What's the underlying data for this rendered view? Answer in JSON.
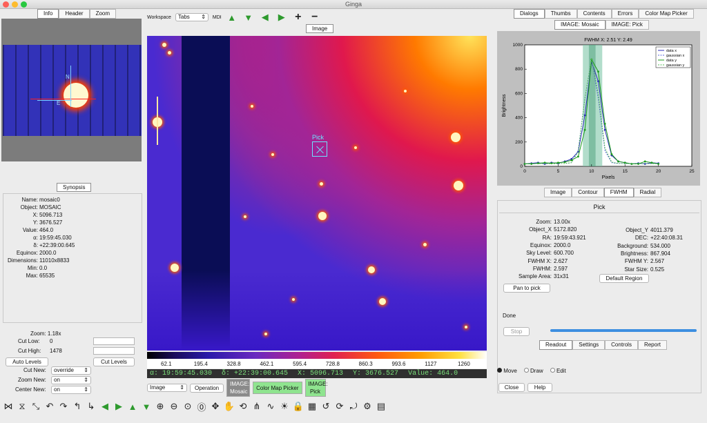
{
  "window": {
    "title": "Ginga"
  },
  "left": {
    "top_tabs": [
      "Info",
      "Header",
      "Zoom"
    ],
    "synopsis_label": "Synopsis",
    "info": [
      [
        "Name:",
        "mosaic0"
      ],
      [
        "Object:",
        "MOSAIC"
      ],
      [
        "X:",
        "5096.713"
      ],
      [
        "Y:",
        "3676.527"
      ],
      [
        "Value:",
        "464.0"
      ],
      [
        "α:",
        "19:59:45.030"
      ],
      [
        "δ:",
        "+22:39:00.645"
      ],
      [
        "Equinox:",
        "2000.0"
      ],
      [
        "Dimensions:",
        "11010x8833"
      ],
      [
        "Min:",
        "0.0"
      ],
      [
        "Max:",
        "65535"
      ]
    ],
    "zoom": "Zoom: 1.18x",
    "cut_low_label": "Cut Low:",
    "cut_low": "0",
    "cut_high_label": "Cut High:",
    "cut_high": "1478",
    "auto_levels": "Auto Levels",
    "cut_levels": "Cut Levels",
    "cut_new_label": "Cut New:",
    "cut_new": "override",
    "zoom_new_label": "Zoom New:",
    "zoom_new": "on",
    "center_new_label": "Center New:",
    "center_new": "on"
  },
  "center": {
    "workspace_label": "Workspace",
    "workspace_type": "Tabs",
    "mdi_label": "MDI",
    "image_tab": "Image",
    "pick_label": "Pick",
    "colorbar_ticks": [
      "62.1",
      "195.4",
      "328.8",
      "462.1",
      "595.4",
      "728.8",
      "860.3",
      "993.6",
      "1127",
      "1260"
    ],
    "readout": {
      "ra": "α: 19:59:45.030",
      "dec": "δ: +22:39:00.645",
      "x": "X: 5096.713",
      "y": "Y: 3676.527",
      "value": "Value: 464.0"
    },
    "channel_select": "Image",
    "operation": "Operation",
    "bottom_tabs": [
      [
        "IMAGE:",
        "Mosaic"
      ],
      [
        "Color Map Picker",
        ""
      ],
      [
        "IMAGE:",
        "Pick"
      ]
    ]
  },
  "right": {
    "top_tabs": [
      "Dialogs",
      "Thumbs",
      "Contents",
      "Errors",
      "Color Map Picker"
    ],
    "image_tabs": [
      "IMAGE: Mosaic",
      "IMAGE: Pick"
    ],
    "plot_tabs": [
      "Image",
      "Contour",
      "FWHM",
      "Radial"
    ],
    "pick_title": "Pick",
    "pick_left": [
      [
        "Zoom:",
        "13.00x"
      ],
      [
        "Object_X",
        "5172.820"
      ],
      [
        "RA:",
        "19:59:43.921"
      ],
      [
        "Equinox:",
        "2000.0"
      ],
      [
        "Sky Level:",
        "600.700"
      ],
      [
        "FWHM X:",
        "2.627"
      ],
      [
        "FWHM:",
        "2.597"
      ],
      [
        "Sample Area:",
        "31x31"
      ]
    ],
    "pick_right": [
      [
        "Object_Y",
        "4011.379"
      ],
      [
        "DEC:",
        "+22:40:08.31"
      ],
      [
        "Background:",
        "534.000"
      ],
      [
        "Brightness:",
        "867.904"
      ],
      [
        "FWHM Y:",
        "2.567"
      ],
      [
        "Star Size:",
        "0.525"
      ]
    ],
    "pan_to_pick": "Pan to pick",
    "default_region": "Default Region",
    "status": "Done",
    "stop": "Stop",
    "progress": 1.0,
    "lower_tabs": [
      "Readout",
      "Settings",
      "Controls",
      "Report"
    ],
    "modes": [
      "Move",
      "Draw",
      "Edit"
    ],
    "close": "Close",
    "help": "Help"
  },
  "chart_data": {
    "type": "line",
    "title": "FWHM X: 2.51  Y: 2.49",
    "xlabel": "Pixels",
    "ylabel": "Brightness",
    "xlim": [
      0,
      25
    ],
    "ylim": [
      0,
      1000
    ],
    "xticks": [
      "0",
      "5",
      "10",
      "15",
      "20",
      "25"
    ],
    "yticks": [
      "0",
      "200",
      "400",
      "600",
      "800",
      "1000"
    ],
    "legend_position": "top-right",
    "series": [
      {
        "name": "data x",
        "color": "#2b2bb8",
        "x": [
          0,
          1,
          2,
          3,
          4,
          5,
          6,
          7,
          8,
          9,
          10,
          11,
          12,
          13,
          14,
          15,
          16,
          17,
          18,
          19,
          20
        ],
        "values": [
          20,
          25,
          30,
          20,
          30,
          25,
          40,
          60,
          120,
          420,
          860,
          700,
          300,
          90,
          40,
          30,
          20,
          25,
          20,
          30,
          25
        ]
      },
      {
        "name": "gaussian x",
        "color": "#5566dd",
        "x": [
          0,
          1,
          2,
          3,
          4,
          5,
          6,
          7,
          8,
          9,
          10,
          11,
          12,
          13,
          14,
          15,
          16,
          17,
          18,
          19,
          20
        ],
        "values": [
          22,
          22,
          22,
          22,
          22,
          22,
          23,
          30,
          130,
          560,
          880,
          560,
          130,
          30,
          23,
          22,
          22,
          22,
          22,
          22,
          22
        ]
      },
      {
        "name": "data y",
        "color": "#1a9a1a",
        "x": [
          0,
          1,
          2,
          3,
          4,
          5,
          6,
          7,
          8,
          9,
          10,
          11,
          12,
          13,
          14,
          15,
          16,
          17,
          18,
          19,
          20
        ],
        "values": [
          20,
          20,
          25,
          30,
          25,
          30,
          35,
          50,
          80,
          300,
          880,
          780,
          350,
          100,
          40,
          30,
          20,
          20,
          40,
          30,
          20
        ]
      },
      {
        "name": "gaussian y",
        "color": "#55bb55",
        "x": [
          0,
          1,
          2,
          3,
          4,
          5,
          6,
          7,
          8,
          9,
          10,
          11,
          12,
          13,
          14,
          15,
          16,
          17,
          18,
          19,
          20
        ],
        "values": [
          22,
          22,
          22,
          22,
          22,
          22,
          23,
          30,
          120,
          560,
          890,
          600,
          150,
          35,
          23,
          22,
          22,
          22,
          22,
          22,
          22
        ]
      }
    ]
  }
}
